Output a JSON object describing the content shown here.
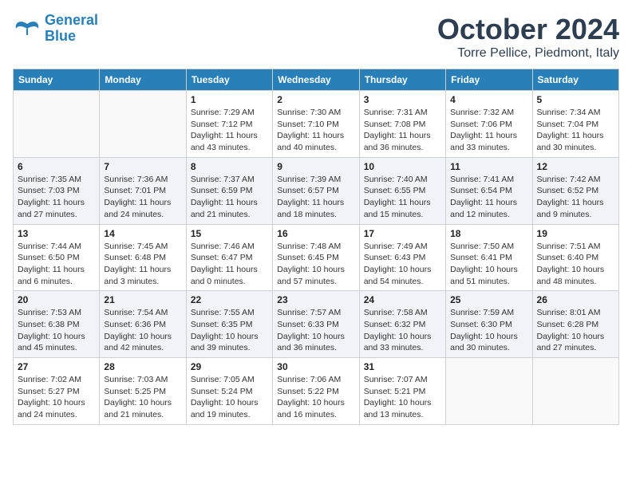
{
  "header": {
    "logo_line1": "General",
    "logo_line2": "Blue",
    "month": "October 2024",
    "location": "Torre Pellice, Piedmont, Italy"
  },
  "weekdays": [
    "Sunday",
    "Monday",
    "Tuesday",
    "Wednesday",
    "Thursday",
    "Friday",
    "Saturday"
  ],
  "weeks": [
    [
      {
        "day": "",
        "sunrise": "",
        "sunset": "",
        "daylight": ""
      },
      {
        "day": "",
        "sunrise": "",
        "sunset": "",
        "daylight": ""
      },
      {
        "day": "1",
        "sunrise": "Sunrise: 7:29 AM",
        "sunset": "Sunset: 7:12 PM",
        "daylight": "Daylight: 11 hours and 43 minutes."
      },
      {
        "day": "2",
        "sunrise": "Sunrise: 7:30 AM",
        "sunset": "Sunset: 7:10 PM",
        "daylight": "Daylight: 11 hours and 40 minutes."
      },
      {
        "day": "3",
        "sunrise": "Sunrise: 7:31 AM",
        "sunset": "Sunset: 7:08 PM",
        "daylight": "Daylight: 11 hours and 36 minutes."
      },
      {
        "day": "4",
        "sunrise": "Sunrise: 7:32 AM",
        "sunset": "Sunset: 7:06 PM",
        "daylight": "Daylight: 11 hours and 33 minutes."
      },
      {
        "day": "5",
        "sunrise": "Sunrise: 7:34 AM",
        "sunset": "Sunset: 7:04 PM",
        "daylight": "Daylight: 11 hours and 30 minutes."
      }
    ],
    [
      {
        "day": "6",
        "sunrise": "Sunrise: 7:35 AM",
        "sunset": "Sunset: 7:03 PM",
        "daylight": "Daylight: 11 hours and 27 minutes."
      },
      {
        "day": "7",
        "sunrise": "Sunrise: 7:36 AM",
        "sunset": "Sunset: 7:01 PM",
        "daylight": "Daylight: 11 hours and 24 minutes."
      },
      {
        "day": "8",
        "sunrise": "Sunrise: 7:37 AM",
        "sunset": "Sunset: 6:59 PM",
        "daylight": "Daylight: 11 hours and 21 minutes."
      },
      {
        "day": "9",
        "sunrise": "Sunrise: 7:39 AM",
        "sunset": "Sunset: 6:57 PM",
        "daylight": "Daylight: 11 hours and 18 minutes."
      },
      {
        "day": "10",
        "sunrise": "Sunrise: 7:40 AM",
        "sunset": "Sunset: 6:55 PM",
        "daylight": "Daylight: 11 hours and 15 minutes."
      },
      {
        "day": "11",
        "sunrise": "Sunrise: 7:41 AM",
        "sunset": "Sunset: 6:54 PM",
        "daylight": "Daylight: 11 hours and 12 minutes."
      },
      {
        "day": "12",
        "sunrise": "Sunrise: 7:42 AM",
        "sunset": "Sunset: 6:52 PM",
        "daylight": "Daylight: 11 hours and 9 minutes."
      }
    ],
    [
      {
        "day": "13",
        "sunrise": "Sunrise: 7:44 AM",
        "sunset": "Sunset: 6:50 PM",
        "daylight": "Daylight: 11 hours and 6 minutes."
      },
      {
        "day": "14",
        "sunrise": "Sunrise: 7:45 AM",
        "sunset": "Sunset: 6:48 PM",
        "daylight": "Daylight: 11 hours and 3 minutes."
      },
      {
        "day": "15",
        "sunrise": "Sunrise: 7:46 AM",
        "sunset": "Sunset: 6:47 PM",
        "daylight": "Daylight: 11 hours and 0 minutes."
      },
      {
        "day": "16",
        "sunrise": "Sunrise: 7:48 AM",
        "sunset": "Sunset: 6:45 PM",
        "daylight": "Daylight: 10 hours and 57 minutes."
      },
      {
        "day": "17",
        "sunrise": "Sunrise: 7:49 AM",
        "sunset": "Sunset: 6:43 PM",
        "daylight": "Daylight: 10 hours and 54 minutes."
      },
      {
        "day": "18",
        "sunrise": "Sunrise: 7:50 AM",
        "sunset": "Sunset: 6:41 PM",
        "daylight": "Daylight: 10 hours and 51 minutes."
      },
      {
        "day": "19",
        "sunrise": "Sunrise: 7:51 AM",
        "sunset": "Sunset: 6:40 PM",
        "daylight": "Daylight: 10 hours and 48 minutes."
      }
    ],
    [
      {
        "day": "20",
        "sunrise": "Sunrise: 7:53 AM",
        "sunset": "Sunset: 6:38 PM",
        "daylight": "Daylight: 10 hours and 45 minutes."
      },
      {
        "day": "21",
        "sunrise": "Sunrise: 7:54 AM",
        "sunset": "Sunset: 6:36 PM",
        "daylight": "Daylight: 10 hours and 42 minutes."
      },
      {
        "day": "22",
        "sunrise": "Sunrise: 7:55 AM",
        "sunset": "Sunset: 6:35 PM",
        "daylight": "Daylight: 10 hours and 39 minutes."
      },
      {
        "day": "23",
        "sunrise": "Sunrise: 7:57 AM",
        "sunset": "Sunset: 6:33 PM",
        "daylight": "Daylight: 10 hours and 36 minutes."
      },
      {
        "day": "24",
        "sunrise": "Sunrise: 7:58 AM",
        "sunset": "Sunset: 6:32 PM",
        "daylight": "Daylight: 10 hours and 33 minutes."
      },
      {
        "day": "25",
        "sunrise": "Sunrise: 7:59 AM",
        "sunset": "Sunset: 6:30 PM",
        "daylight": "Daylight: 10 hours and 30 minutes."
      },
      {
        "day": "26",
        "sunrise": "Sunrise: 8:01 AM",
        "sunset": "Sunset: 6:28 PM",
        "daylight": "Daylight: 10 hours and 27 minutes."
      }
    ],
    [
      {
        "day": "27",
        "sunrise": "Sunrise: 7:02 AM",
        "sunset": "Sunset: 5:27 PM",
        "daylight": "Daylight: 10 hours and 24 minutes."
      },
      {
        "day": "28",
        "sunrise": "Sunrise: 7:03 AM",
        "sunset": "Sunset: 5:25 PM",
        "daylight": "Daylight: 10 hours and 21 minutes."
      },
      {
        "day": "29",
        "sunrise": "Sunrise: 7:05 AM",
        "sunset": "Sunset: 5:24 PM",
        "daylight": "Daylight: 10 hours and 19 minutes."
      },
      {
        "day": "30",
        "sunrise": "Sunrise: 7:06 AM",
        "sunset": "Sunset: 5:22 PM",
        "daylight": "Daylight: 10 hours and 16 minutes."
      },
      {
        "day": "31",
        "sunrise": "Sunrise: 7:07 AM",
        "sunset": "Sunset: 5:21 PM",
        "daylight": "Daylight: 10 hours and 13 minutes."
      },
      {
        "day": "",
        "sunrise": "",
        "sunset": "",
        "daylight": ""
      },
      {
        "day": "",
        "sunrise": "",
        "sunset": "",
        "daylight": ""
      }
    ]
  ]
}
